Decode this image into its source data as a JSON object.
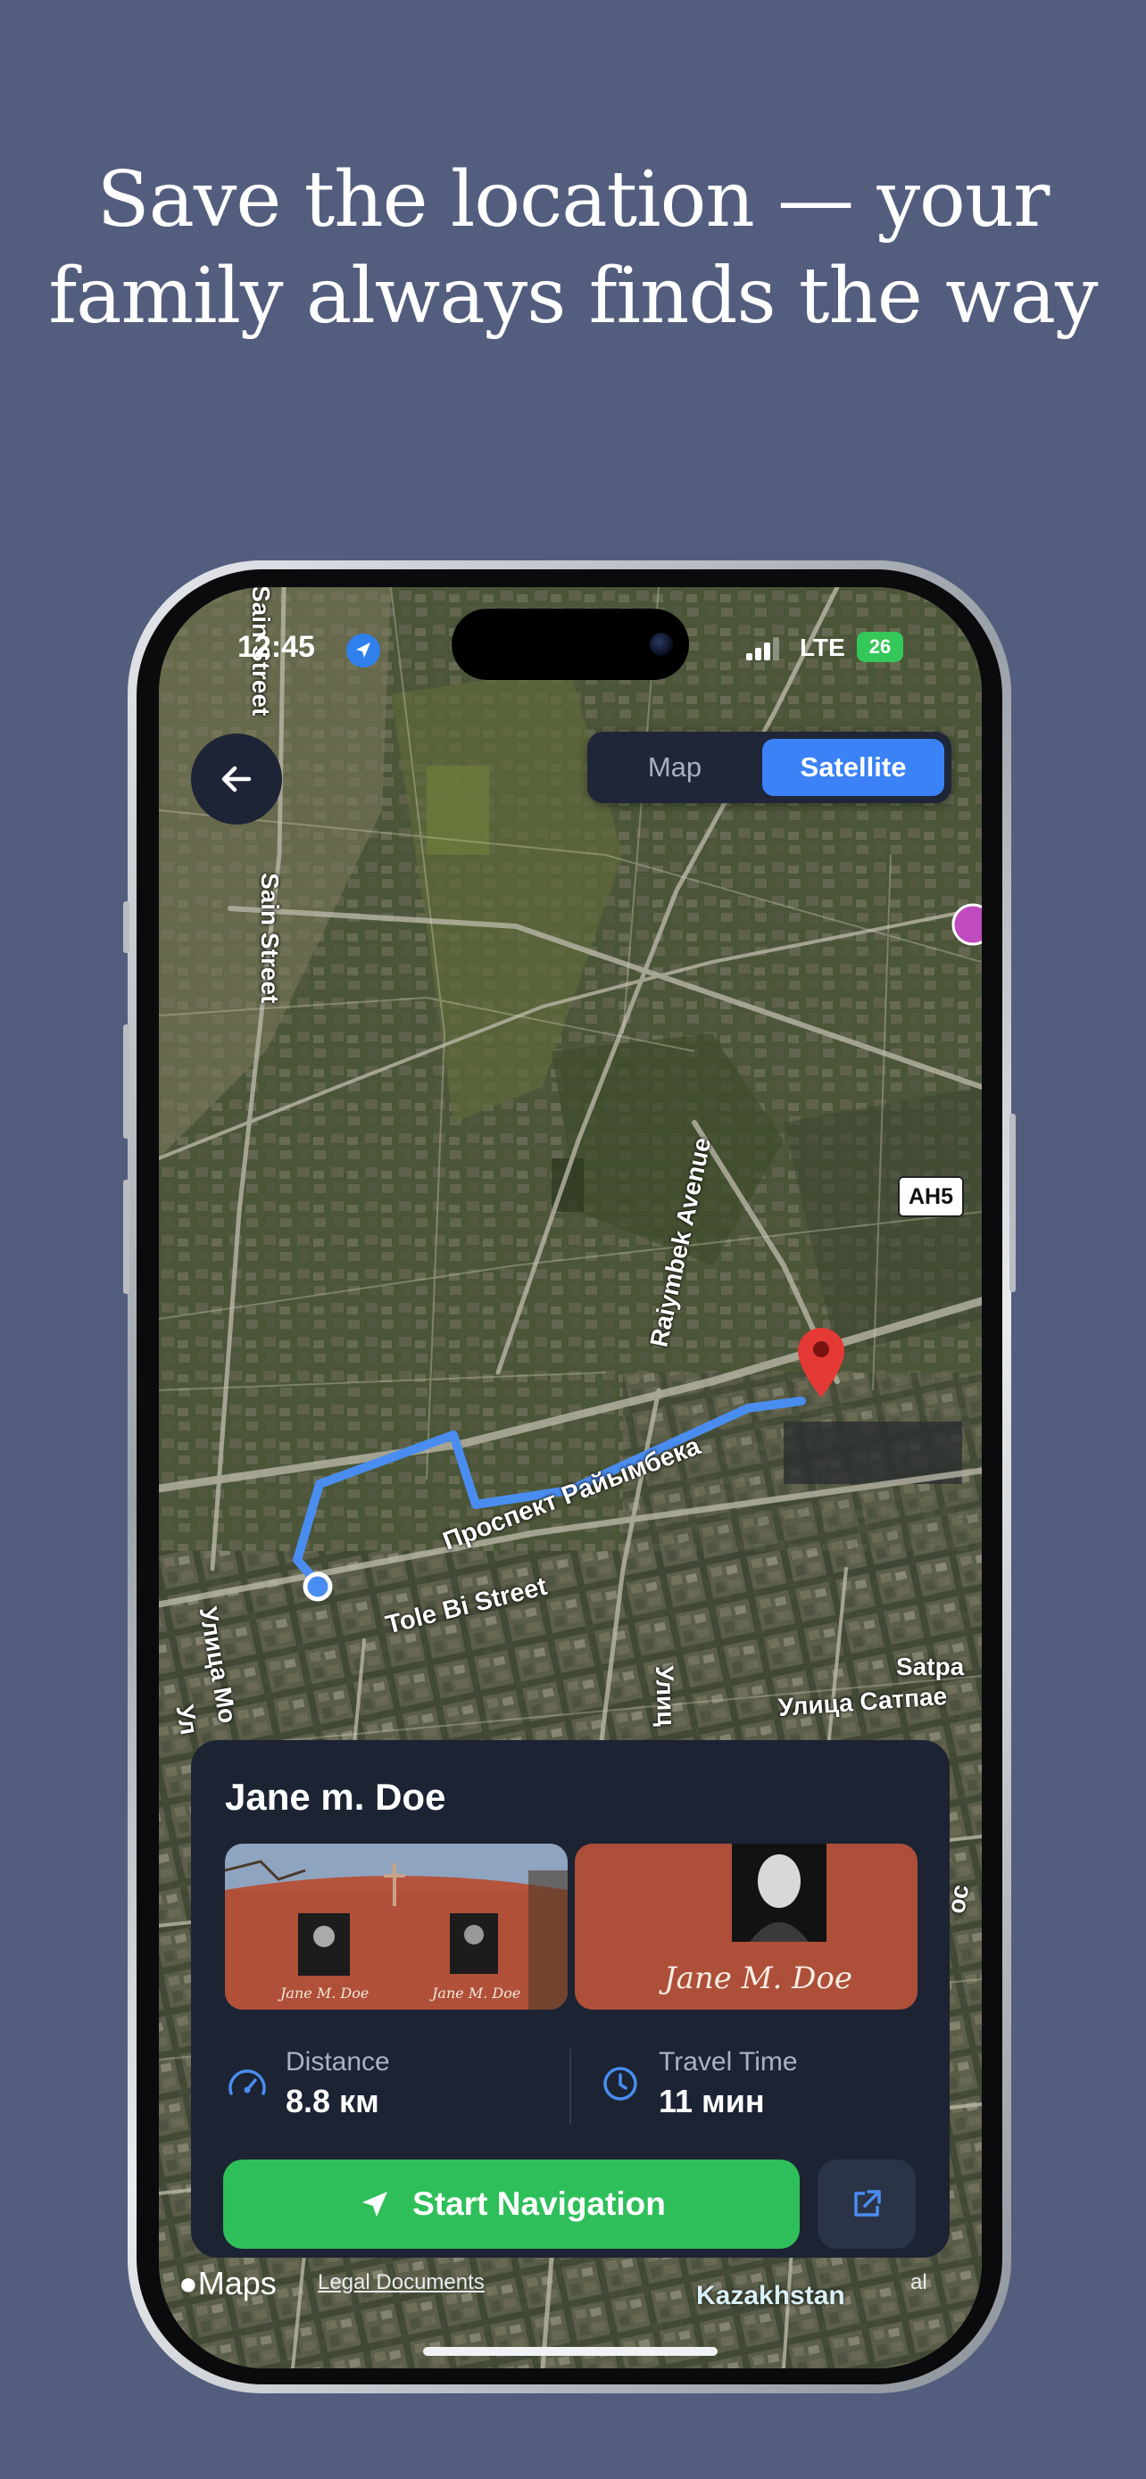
{
  "headline": {
    "line1": "Save the location — your",
    "line2": "family always finds the way"
  },
  "status_bar": {
    "time": "12:45",
    "network": "LTE",
    "battery": "26"
  },
  "map": {
    "mode_options": [
      "Map",
      "Satellite"
    ],
    "selected_mode": "Satellite",
    "labels": {
      "sain_street_top": "Sain Street",
      "sain_street": "Sain Street",
      "raiymbek_avenue": "Raiymbek Avenue",
      "prospekt": "Проспект Райымбека",
      "tole_bi": "Tole Bi Street",
      "ulica_left": "Улица Мо",
      "ulica_left2": "Ул",
      "ulica_mid": "Улиц",
      "satpa": "Satpa",
      "ulica_satpaeva": "Улица Сатпае",
      "kazakhstan": "Kazakhstan",
      "right_edge": "ос"
    },
    "route_shield": "AH5",
    "destination_pin": "red-map-pin"
  },
  "card": {
    "name": "Jane m. Doe",
    "photo_captions": [
      "Jane M. Doe",
      "Jane M. Doe"
    ],
    "photo_caption_large": "Jane M. Doe",
    "distance": {
      "label": "Distance",
      "value": "8.8 км"
    },
    "travel_time": {
      "label": "Travel Time",
      "value": "11 мин"
    },
    "start_navigation": "Start Navigation"
  },
  "footer": {
    "maps_brand": "Maps",
    "legal": "Legal Documents",
    "legal_right": "al"
  },
  "colors": {
    "background": "#535e7e",
    "card": "#1c2333",
    "accent_blue": "#3b82f6",
    "nav_green": "#2fbf5a",
    "route": "#4a8df0",
    "pin": "#e53935"
  }
}
